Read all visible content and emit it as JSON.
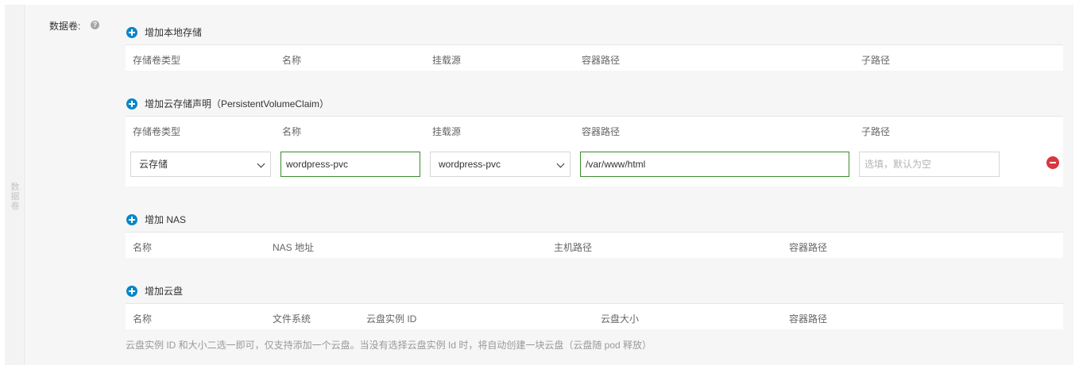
{
  "side_label": "数据卷",
  "field_label": "数据卷:",
  "help_icon": "?",
  "local_storage": {
    "add_label": "增加本地存储",
    "columns": [
      "存储卷类型",
      "名称",
      "挂载源",
      "容器路径",
      "子路径"
    ]
  },
  "pvc": {
    "add_label": "增加云存储声明（PersistentVolumeClaim）",
    "columns": [
      "存储卷类型",
      "名称",
      "挂载源",
      "容器路径",
      "子路径"
    ],
    "row": {
      "type": "云存储",
      "name": "wordpress-pvc",
      "source": "wordpress-pvc",
      "container_path": "/var/www/html",
      "subpath_placeholder": "选填，默认为空"
    }
  },
  "nas": {
    "add_label": "增加 NAS",
    "columns": [
      "名称",
      "NAS 地址",
      "主机路径",
      "容器路径"
    ]
  },
  "disk": {
    "add_label": "增加云盘",
    "columns": [
      "名称",
      "文件系统",
      "云盘实例 ID",
      "云盘大小",
      "容器路径"
    ]
  },
  "footnote": "云盘实例 ID 和大小二选一即可，仅支持添加一个云盘。当没有选择云盘实例 Id 时，将自动创建一块云盘（云盘随 pod 释放）",
  "colors": {
    "accent": "#0a86c7",
    "valid_border": "#3b8b2f",
    "danger": "#d9363e"
  },
  "icons": {
    "add": "plus-circle-icon",
    "remove": "minus-circle-icon",
    "help": "question-icon",
    "dropdown": "chevron-down-icon"
  }
}
